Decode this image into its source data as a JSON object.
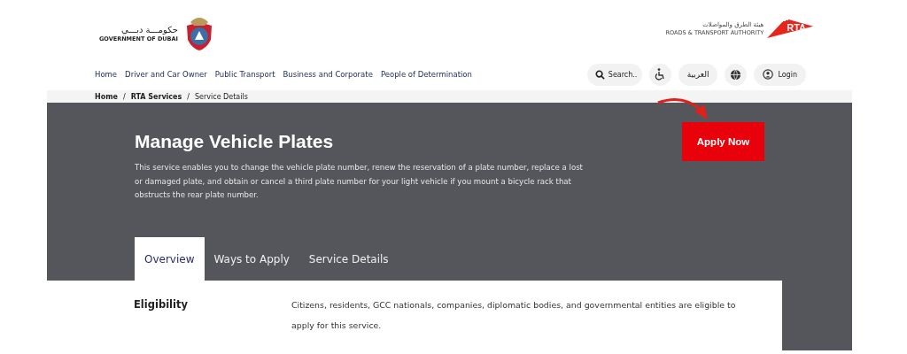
{
  "header": {
    "gov_logo": {
      "arabic": "حكومـــة دبـــي",
      "english": "GOVERNMENT OF DUBAI"
    },
    "rta_logo": {
      "arabic": "هيئة الطرق والمواصلات",
      "english": "ROADS & TRANSPORT AUTHORITY",
      "mark": "RTA"
    }
  },
  "nav": {
    "items": [
      "Home",
      "Driver and Car Owner",
      "Public Transport",
      "Business and Corporate",
      "People of Determination"
    ],
    "search": {
      "placeholder": "Search.."
    },
    "language": "العربية",
    "login": "Login"
  },
  "breadcrumb": {
    "items": [
      "Home",
      "RTA Services",
      "Service Details"
    ],
    "separator": "/"
  },
  "hero": {
    "title": "Manage Vehicle Plates",
    "description": "This service enables you to change the vehicle plate number, renew the reservation of a plate number, replace a lost or damaged plate, and obtain or cancel a third plate number for your light vehicle if you mount a bicycle rack that obstructs the rear plate number.",
    "apply_button": "Apply Now"
  },
  "tabs": [
    {
      "label": "Overview",
      "selected": true
    },
    {
      "label": "Ways to Apply",
      "selected": false
    },
    {
      "label": "Service Details",
      "selected": false
    }
  ],
  "overview": {
    "label": "Eligibility",
    "text": "Citizens, residents, GCC nationals, companies, diplomatic bodies, and governmental entities are eligible to apply for this service."
  }
}
